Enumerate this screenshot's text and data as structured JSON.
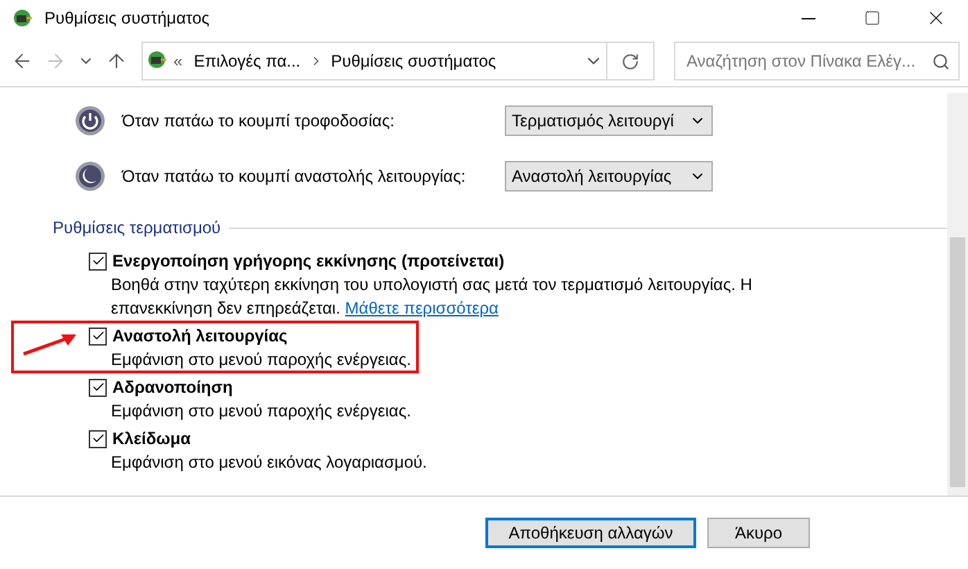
{
  "window": {
    "title": "Ρυθμίσεις συστήματος"
  },
  "address_bar": {
    "overflow": "«",
    "crumbs": [
      "Επιλογές πα...",
      "Ρυθμίσεις συστήματος"
    ]
  },
  "search": {
    "placeholder": "Αναζήτηση στον Πίνακα Ελέγ..."
  },
  "button_actions": [
    {
      "kind": "power",
      "label": "Όταν πατάω το κουμπί τροφοδοσίας:",
      "value": "Τερματισμός λειτουργί"
    },
    {
      "kind": "sleep",
      "label": "Όταν πατάω το κουμπί αναστολής λειτουργίας:",
      "value": "Αναστολή λειτουργίας"
    }
  ],
  "shutdown_settings": {
    "heading": "Ρυθμίσεις τερματισμού",
    "options": [
      {
        "label": "Ενεργοποίηση γρήγορης εκκίνησης (προτείνεται)",
        "checked": true,
        "highlighted": false,
        "description": "Βοηθά στην ταχύτερη εκκίνηση του υπολογιστή σας μετά τον τερματισμό λειτουργίας. Η επανεκκίνηση δεν επηρεάζεται.",
        "link": "Μάθετε περισσότερα"
      },
      {
        "label": "Αναστολή λειτουργίας",
        "checked": true,
        "highlighted": true,
        "description": "Εμφάνιση στο μενού παροχής ενέργειας."
      },
      {
        "label": "Αδρανοποίηση",
        "checked": true,
        "highlighted": false,
        "description": "Εμφάνιση στο μενού παροχής ενέργειας."
      },
      {
        "label": "Κλείδωμα",
        "checked": true,
        "highlighted": false,
        "description": "Εμφάνιση στο μενού εικόνας λογαριασμού."
      }
    ]
  },
  "buttons": [
    {
      "label": "Αποθήκευση αλλαγών",
      "default": true
    },
    {
      "label": "Άκυρο",
      "default": false
    }
  ]
}
